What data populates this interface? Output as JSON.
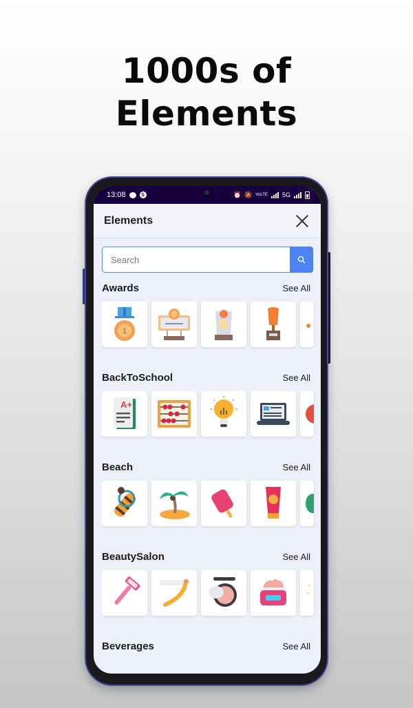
{
  "headline": {
    "line1": "1000s of",
    "line2": "Elements"
  },
  "statusbar": {
    "time": "13:08",
    "network_label": "5G",
    "icons": [
      "chat-bubble-icon",
      "s-app-icon",
      "alarm-icon",
      "mute-icon",
      "volte-icon",
      "signal-icon",
      "signal-icon",
      "battery-icon"
    ]
  },
  "appbar": {
    "title": "Elements",
    "close_icon": "close-icon"
  },
  "search": {
    "placeholder": "Search",
    "value": "",
    "button_icon": "search-icon"
  },
  "sections": [
    {
      "title": "Awards",
      "see_all": "See All",
      "items": [
        "medal",
        "certificate-plaque",
        "glass-trophy",
        "cup-trophy",
        "partial-item"
      ]
    },
    {
      "title": "BackToSchool",
      "see_all": "See All",
      "items": [
        "a-plus-paper",
        "abacus",
        "lightbulb-idea",
        "laptop",
        "partial-basketball"
      ]
    },
    {
      "title": "Beach",
      "see_all": "See All",
      "items": [
        "diving-tank",
        "palm-island",
        "popsicle",
        "sunscreen",
        "partial-flipflop"
      ]
    },
    {
      "title": "BeautySalon",
      "see_all": "See All",
      "items": [
        "razor",
        "straight-razor",
        "compact-powder",
        "cream-jar",
        "partial-sparkle"
      ]
    },
    {
      "title": "Beverages",
      "see_all": "See All",
      "items": []
    }
  ],
  "colors": {
    "statusbar": "#18003f",
    "search_button": "#4c82f2",
    "search_border": "#4a8bc9",
    "screen_bg": "#edf0f8",
    "phone_frame": "#4b4aa3"
  }
}
